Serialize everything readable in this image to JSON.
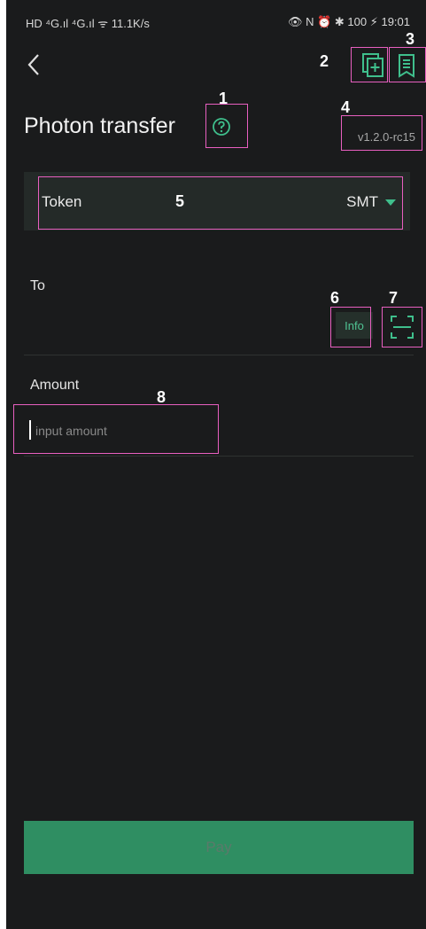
{
  "statusbar": {
    "left_text": "HD ⁴G.ıl ⁴G.ıl ᯤ 11.1K/s",
    "right_text": "👁 N ⏰ ✱ 100 ⚡ 19:01"
  },
  "header": {
    "title": "Photon transfer",
    "version": "v1.2.0-rc15",
    "icons": [
      "back-icon",
      "add-document-icon",
      "list-document-icon",
      "help-circle-icon"
    ]
  },
  "token": {
    "label": "Token",
    "value": "SMT"
  },
  "to": {
    "label": "To",
    "info_label": "Info"
  },
  "amount": {
    "label": "Amount",
    "placeholder": "input amount"
  },
  "pay": {
    "label": "Pay"
  },
  "annotations": [
    "1",
    "2",
    "3",
    "4",
    "5",
    "6",
    "7",
    "8"
  ],
  "colors": {
    "background": "#1a1b1c",
    "accent": "#3fbf8c",
    "pay_button": "#2f8e62",
    "annotation_box": "#e85fc0"
  }
}
